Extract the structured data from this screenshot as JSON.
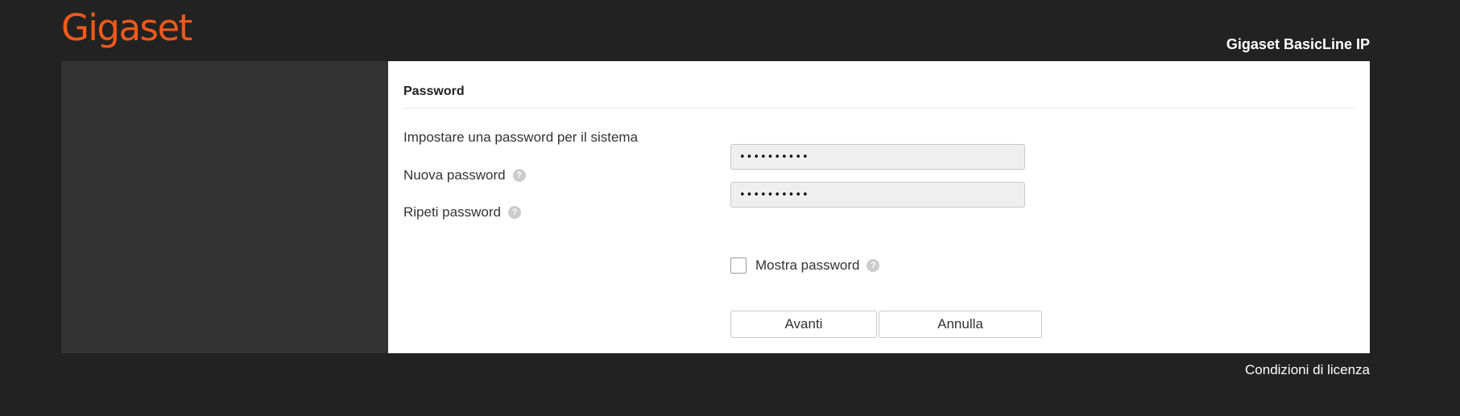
{
  "header": {
    "logo_text": "Gigaset",
    "product_name": "Gigaset BasicLine IP"
  },
  "form": {
    "section_title": "Password",
    "description": "Impostare una password per il sistema",
    "new_password": {
      "label": "Nuova password",
      "value": "••••••••••",
      "help_icon": "question-circle-icon"
    },
    "repeat_password": {
      "label": "Ripeti password",
      "value": "••••••••••",
      "help_icon": "question-circle-icon"
    },
    "show_password": {
      "label": "Mostra password",
      "checked": false,
      "help_icon": "question-circle-icon"
    },
    "buttons": {
      "next": "Avanti",
      "cancel": "Annulla"
    }
  },
  "footer": {
    "license_link": "Condizioni di licenza"
  },
  "colors": {
    "brand": "#f05a1a",
    "background": "#222222",
    "sidebar": "#333333",
    "panel": "#ffffff"
  }
}
